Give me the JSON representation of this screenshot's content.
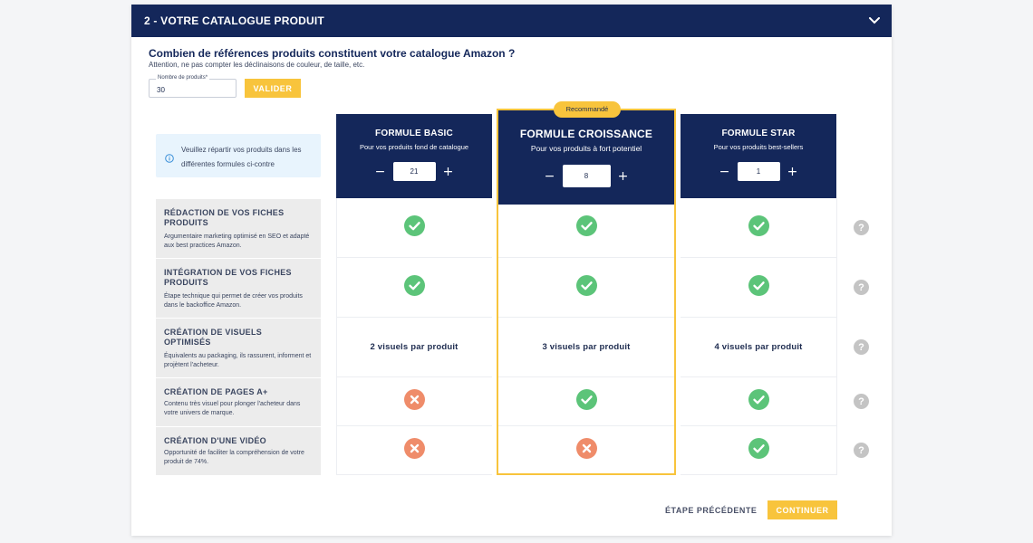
{
  "section": {
    "title": "2 - VOTRE CATALOGUE PRODUIT",
    "toggle_icon": "chevron-down-icon"
  },
  "question": {
    "title": "Combien de références produits constituent votre catalogue Amazon ?",
    "hint": "Attention, ne pas compter les déclinaisons de couleur, de taille, etc."
  },
  "products_field": {
    "label": "Nombre de produits*",
    "value": "30"
  },
  "validate_button": "VALIDER",
  "info_box": {
    "icon": "info-icon",
    "text": "Veuillez répartir vos produits dans les différentes formules ci-contre"
  },
  "recommended_badge": "Recommandé",
  "plans": [
    {
      "name": "FORMULE BASIC",
      "subtitle": "Pour vos produits fond de catalogue",
      "quantity": "21",
      "minus": "−",
      "plus": "+"
    },
    {
      "name": "FORMULE CROISSANCE",
      "subtitle": "Pour vos produits à fort potentiel",
      "quantity": "8",
      "minus": "−",
      "plus": "+"
    },
    {
      "name": "FORMULE STAR",
      "subtitle": "Pour vos produits best-sellers",
      "quantity": "1",
      "minus": "−",
      "plus": "+"
    }
  ],
  "features": [
    {
      "title": "RÉDACTION DE VOS FICHES PRODUITS",
      "description": "Argumentaire marketing optimisé en SEO et adapté aux best practices Amazon.",
      "values": [
        "check",
        "check",
        "check"
      ],
      "help": "?"
    },
    {
      "title": "INTÉGRATION DE VOS FICHES PRODUITS",
      "description": "Étape technique qui permet de créer vos produits dans le backoffice Amazon.",
      "values": [
        "check",
        "check",
        "check"
      ],
      "help": "?"
    },
    {
      "title": "CRÉATION DE VISUELS OPTIMISÉS",
      "description": "Équivalents au packaging, ils rassurent, informent et projètent l'acheteur.",
      "values": [
        "2 visuels par produit",
        "3 visuels par produit",
        "4 visuels par produit"
      ],
      "help": "?"
    },
    {
      "title": "CRÉATION DE PAGES A+",
      "description": "Contenu très visuel pour plonger l'acheteur dans votre univers de marque.",
      "values": [
        "cross",
        "check",
        "check"
      ],
      "help": "?"
    },
    {
      "title": "CRÉATION D'UNE VIDÉO",
      "description": "Opportunité de faciliter la compréhension de votre produit de 74%.",
      "values": [
        "cross",
        "cross",
        "check"
      ],
      "help": "?"
    }
  ],
  "colors": {
    "navy": "#14275a",
    "yellow": "#f8c43c",
    "check_green": "#5cc479",
    "cross_orange": "#ef8c6a"
  },
  "footer": {
    "back_label": "ÉTAPE PRÉCÉDENTE",
    "continue_label": "CONTINUER"
  }
}
